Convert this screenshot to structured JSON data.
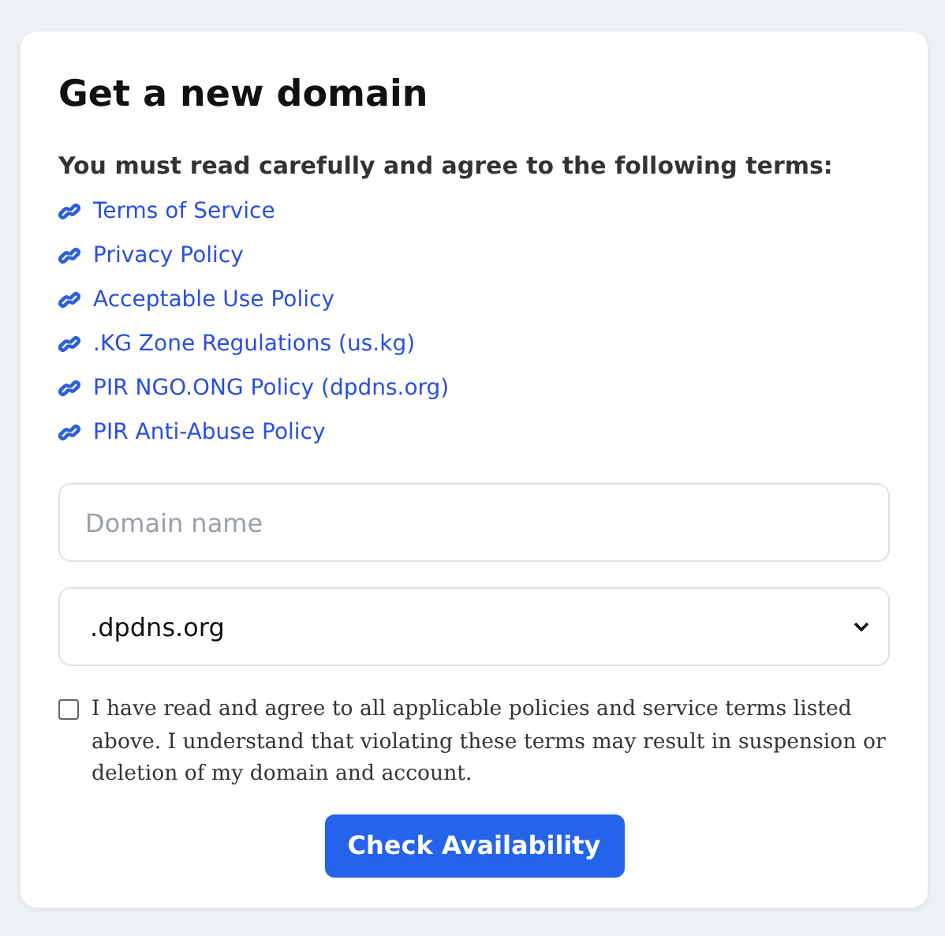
{
  "title": "Get a new domain",
  "terms_heading": "You must read carefully and agree to the following terms:",
  "links": [
    {
      "label": "Terms of Service"
    },
    {
      "label": "Privacy Policy"
    },
    {
      "label": "Acceptable Use Policy"
    },
    {
      "label": ".KG Zone Regulations (us.kg)"
    },
    {
      "label": "PIR NGO.ONG Policy (dpdns.org)"
    },
    {
      "label": "PIR Anti-Abuse Policy"
    }
  ],
  "domain_field": {
    "placeholder": "Domain name"
  },
  "suffix_select": {
    "value": ".dpdns.org"
  },
  "agreement": {
    "checked": false,
    "text": "I have read and agree to all applicable policies and service terms listed above. I understand that violating these terms may result in suspension or deletion of my domain and account."
  },
  "button": "Check Availability"
}
